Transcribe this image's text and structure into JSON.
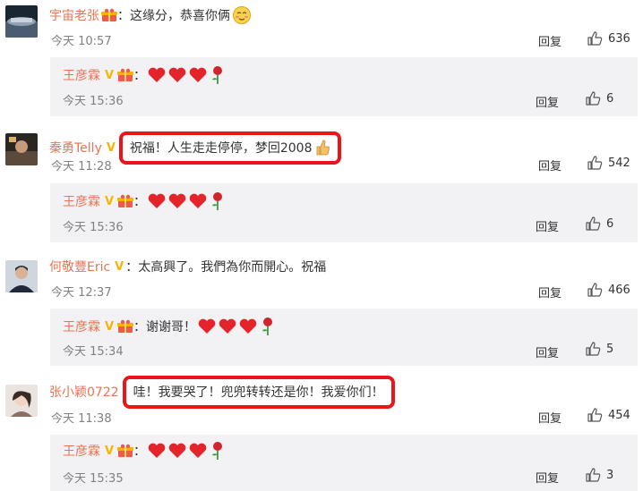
{
  "comments": [
    {
      "user": "宇宙老张",
      "text": "：这缘分，恭喜你俩",
      "time": "今天 10:57",
      "reply_label": "回复",
      "likes": "636",
      "reply": {
        "user": "王彦霖",
        "text": "：",
        "time": "今天 15:36",
        "reply_label": "回复",
        "likes": "6"
      }
    },
    {
      "user": "秦勇Telly",
      "text": "祝福！人生走走停停，梦回2008",
      "time": "今天 11:28",
      "reply_label": "回复",
      "likes": "542",
      "reply": {
        "user": "王彦霖",
        "text": "：",
        "time": "今天 15:36",
        "reply_label": "回复",
        "likes": "6"
      }
    },
    {
      "user": "何敬豐Eric",
      "text": "：太高興了。我們為你而開心。祝福",
      "time": "今天 12:37",
      "reply_label": "回复",
      "likes": "466",
      "reply": {
        "user": "王彦霖",
        "text": "：谢谢哥！",
        "time": "今天 15:34",
        "reply_label": "回复",
        "likes": "5"
      }
    },
    {
      "user": "张小颖0722",
      "text": "哇！我要哭了！兜兜转转还是你！我爱你们！",
      "time": "今天 11:38",
      "reply_label": "回复",
      "likes": "454",
      "reply": {
        "user": "王彦霖",
        "text": "：",
        "time": "今天 15:35",
        "reply_label": "回复",
        "likes": "3"
      }
    }
  ],
  "colors": {
    "username": "#eb7350",
    "highlight_border": "#e8161b",
    "reply_bg": "#f2f2f5",
    "time": "#808080",
    "verified": "#f7b500"
  },
  "icons": [
    "thumbs-up-icon",
    "verified-v-icon",
    "gift-badge-icon",
    "heart-icon",
    "rose-icon",
    "thumb-emoji-icon",
    "blush-emoji-icon"
  ]
}
